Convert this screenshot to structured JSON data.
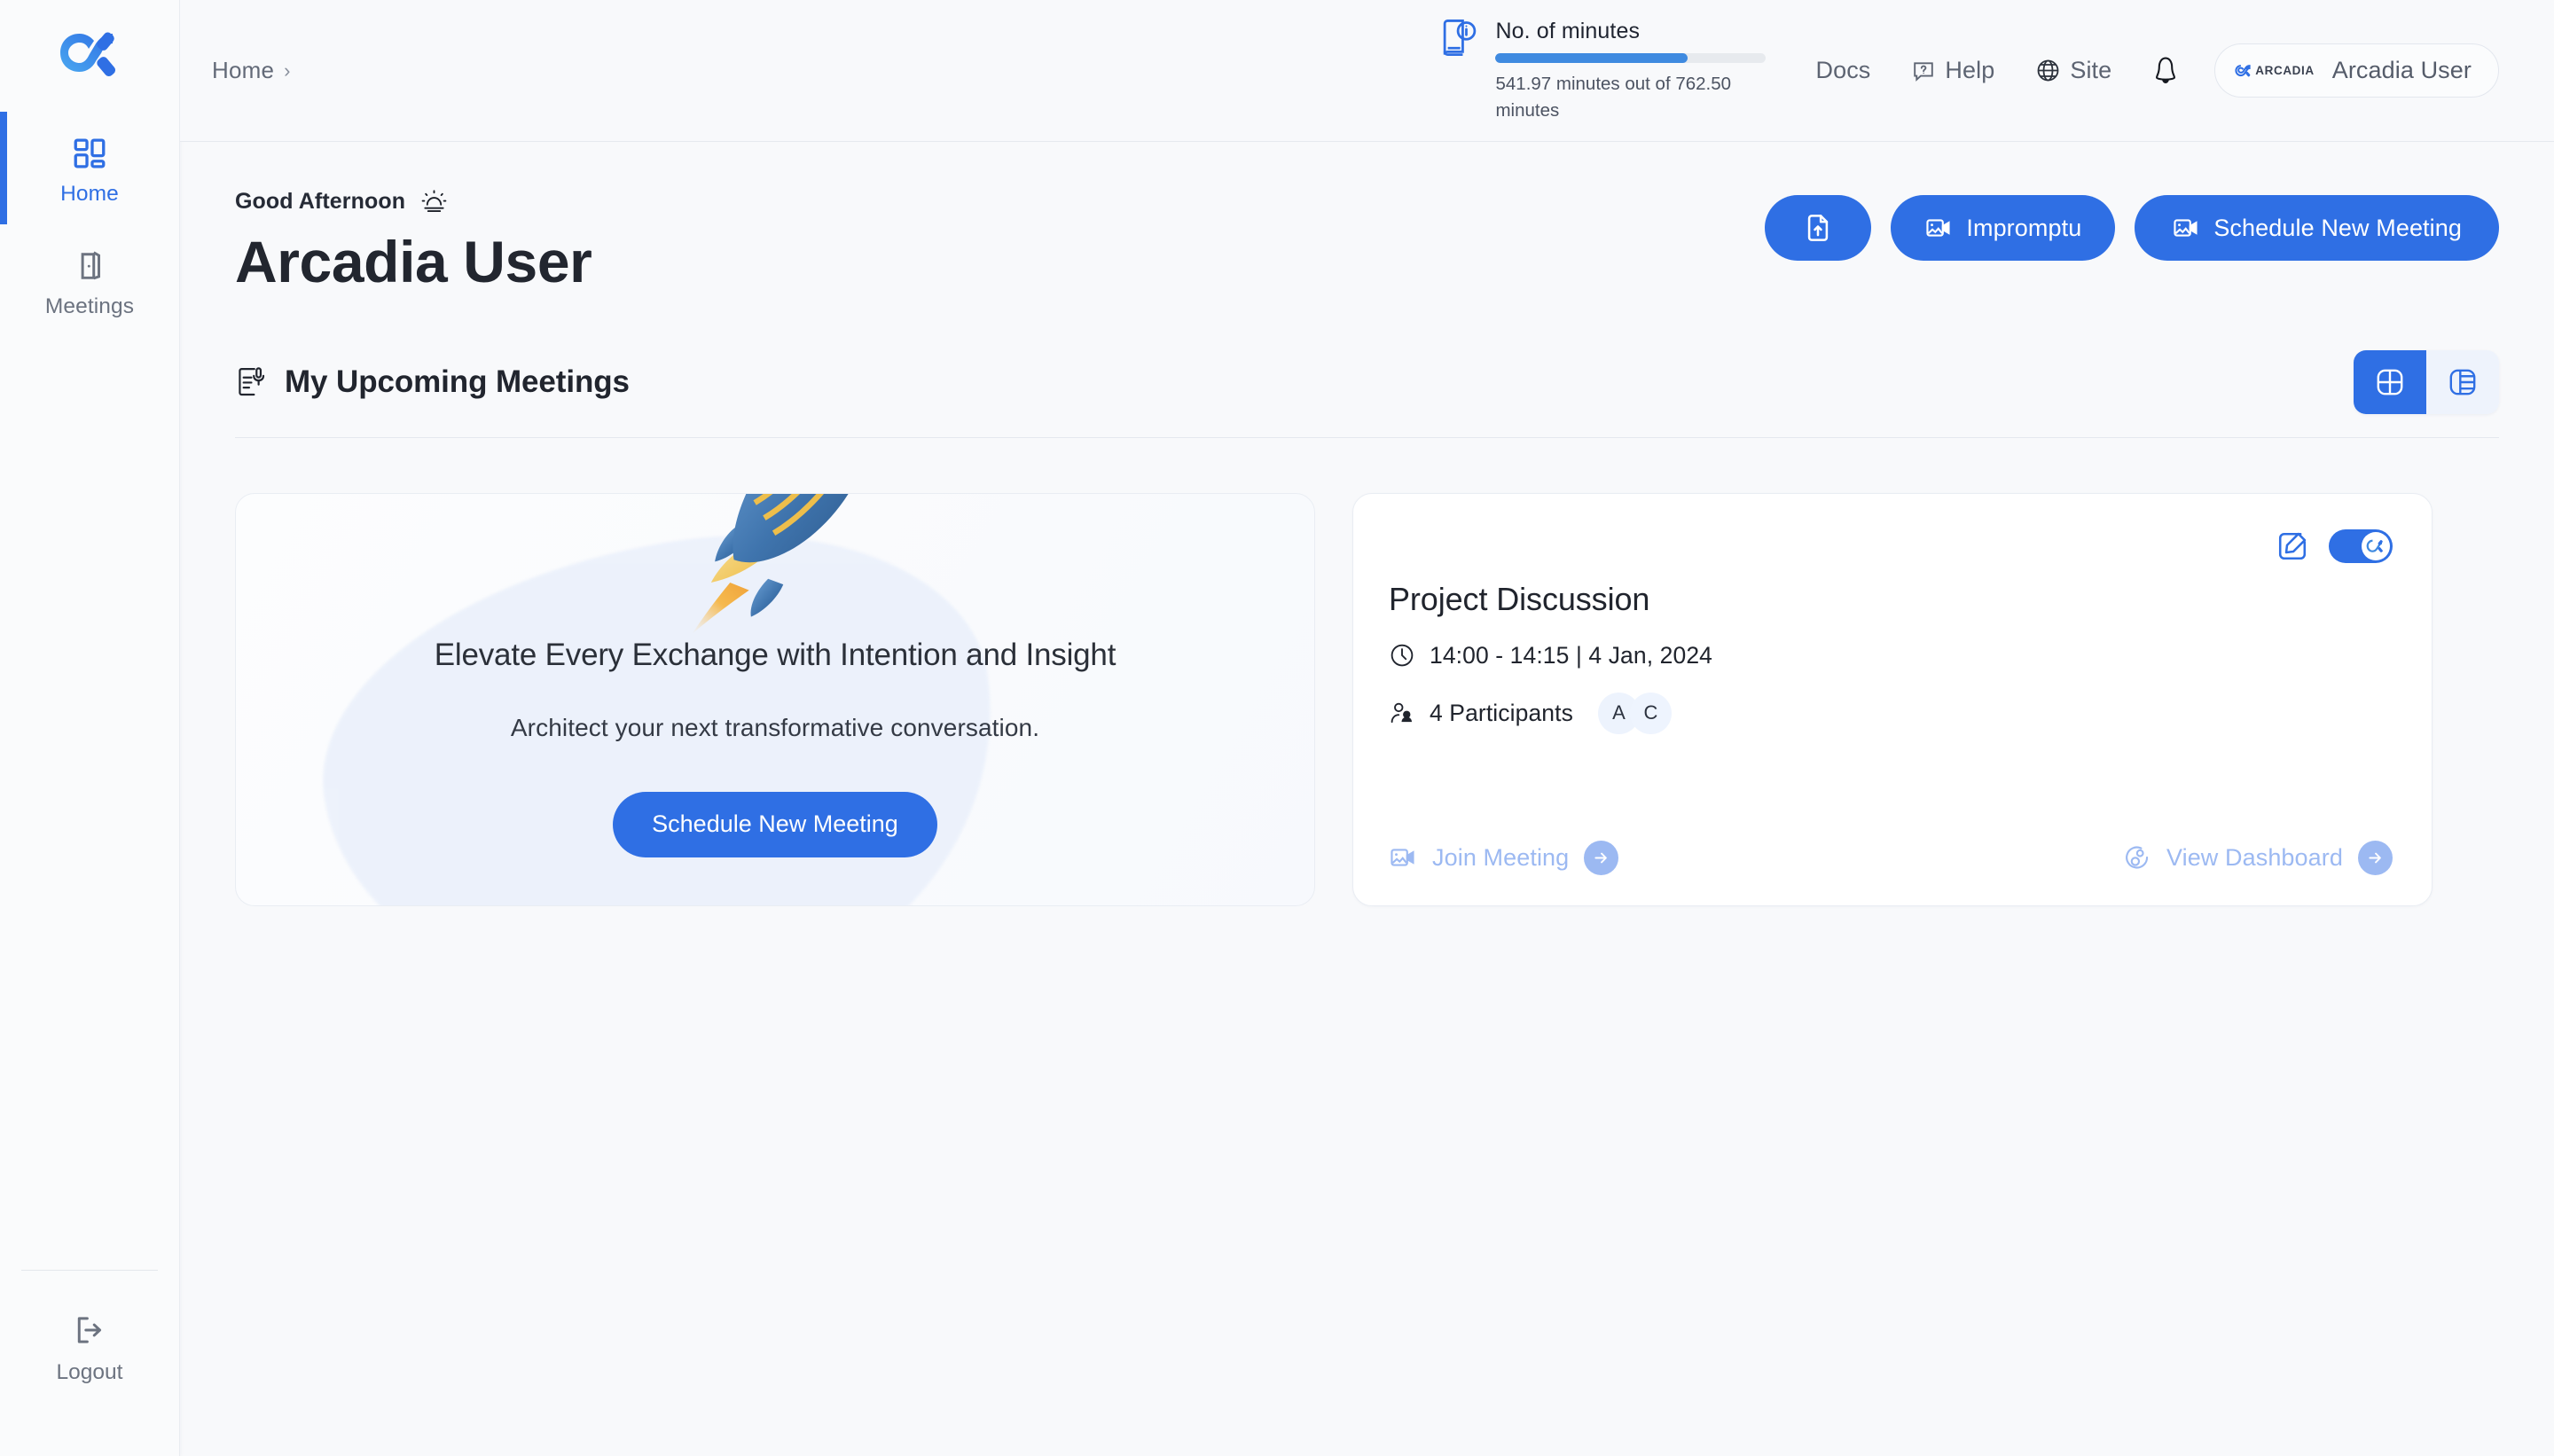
{
  "colors": {
    "brand_blue": "#2f6fe4",
    "progress_fill": "#3f8ae0",
    "muted_blue": "#9cb9f2",
    "page_bg": "#f8f9fb",
    "sidebar_bg": "#fafbfc",
    "card_bg": "#ffffff",
    "text_dark": "#20242d",
    "text_muted": "#6c7380"
  },
  "sidebar": {
    "logo_name": "arcadia-logo",
    "items": [
      {
        "label": "Home",
        "icon": "grid-icon",
        "active": true
      },
      {
        "label": "Meetings",
        "icon": "door-icon",
        "active": false
      }
    ],
    "logout": {
      "label": "Logout",
      "icon": "logout-icon"
    }
  },
  "header": {
    "breadcrumb": {
      "label": "Home",
      "chevron": "›"
    },
    "minutes": {
      "title": "No. of minutes",
      "detail": "541.97 minutes out of 762.50 minutes",
      "used": 541.97,
      "total": 762.5,
      "percent": 71,
      "icon": "book-info-icon"
    },
    "nav": [
      {
        "label": "Docs",
        "icon": null
      },
      {
        "label": "Help",
        "icon": "help-icon"
      },
      {
        "label": "Site",
        "icon": "globe-icon"
      }
    ],
    "notifications_icon": "bell-icon",
    "user": {
      "name": "Arcadia User",
      "brand_text": "ARCADIA",
      "brand_mark": "arcadia-logo-small"
    }
  },
  "hero": {
    "greeting": "Good Afternoon",
    "greeting_icon": "sunrise-icon",
    "username": "Arcadia User",
    "actions": [
      {
        "label": "",
        "name": "upload-document-button",
        "icon": "file-upload-icon"
      },
      {
        "label": "Impromptu",
        "name": "impromptu-button",
        "icon": "video-icon"
      },
      {
        "label": "Schedule New Meeting",
        "name": "schedule-new-meeting-button",
        "icon": "video-icon"
      }
    ]
  },
  "section": {
    "title": "My Upcoming Meetings",
    "icon": "document-mic-icon",
    "view_toggle": [
      {
        "name": "grid-view",
        "icon": "grid-view-icon",
        "active": true
      },
      {
        "name": "list-view",
        "icon": "list-view-icon",
        "active": false
      }
    ]
  },
  "promo_card": {
    "illustration": "rocket-illustration",
    "title": "Elevate Every Exchange with Intention and Insight",
    "subtitle": "Architect your next transformative conversation.",
    "button_label": "Schedule New Meeting"
  },
  "meeting_card": {
    "title": "Project Discussion",
    "time": "14:00 - 14:15 | 4 Jan, 2024",
    "time_icon": "clock-icon",
    "participants_label": "4 Participants",
    "participants_icon": "people-icon",
    "participant_initials": [
      "A",
      "C"
    ],
    "edit_icon": "edit-link-icon",
    "toggle_on": true,
    "actions": {
      "join": {
        "label": "Join Meeting",
        "icon": "video-icon",
        "arrow": "arrow-right-icon"
      },
      "dashboard": {
        "label": "View Dashboard",
        "icon": "analytics-icon",
        "arrow": "arrow-right-icon"
      }
    }
  }
}
